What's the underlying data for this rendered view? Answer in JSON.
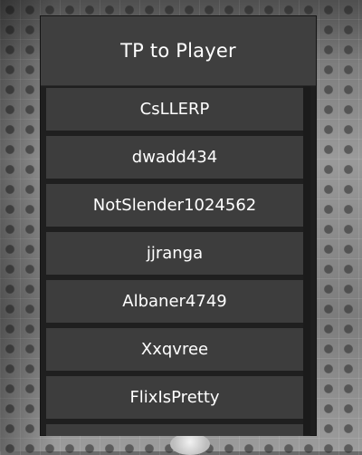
{
  "window": {
    "title": "TP to Player"
  },
  "players": [
    {
      "name": "CsLLERP"
    },
    {
      "name": "dwadd434"
    },
    {
      "name": "NotSlender1024562"
    },
    {
      "name": "jjranga"
    },
    {
      "name": "Albaner4749"
    },
    {
      "name": "Xxqvree"
    },
    {
      "name": "FlixIsPretty"
    },
    {
      "name": ""
    }
  ],
  "colors": {
    "panel_background": "#1f1f1f",
    "header_background": "#3f3f3f",
    "row_background": "#3d3d3d",
    "text": "#ffffff"
  }
}
